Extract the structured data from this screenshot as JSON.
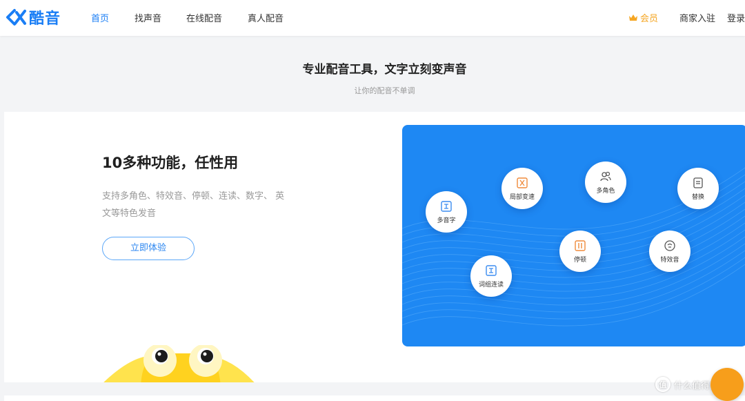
{
  "header": {
    "logo_text": "酷音",
    "brand_color": "#1a7ef5",
    "nav": [
      {
        "label": "首页",
        "active": true
      },
      {
        "label": "找声音",
        "active": false
      },
      {
        "label": "在线配音",
        "active": false
      },
      {
        "label": "真人配音",
        "active": false
      }
    ],
    "vip_label": "会员",
    "vip_color": "#f5a623",
    "merchant_label": "商家入驻",
    "login_label": "登录"
  },
  "intro": {
    "headline": "专业配音工具，文字立刻变声音",
    "subline": "让你的配音不单调"
  },
  "feature": {
    "title": "10多种功能，任性用",
    "description": "支持多角色、特效音、停顿、连读、数字、 英文等特色发音",
    "cta_label": "立即体验",
    "panel_color": "#1e88f3",
    "bubbles": [
      {
        "label": "多音字",
        "icon": "pinyin-icon"
      },
      {
        "label": "局部变速",
        "icon": "speed-icon"
      },
      {
        "label": "多角色",
        "icon": "users-icon"
      },
      {
        "label": "替换",
        "icon": "replace-icon"
      },
      {
        "label": "停顿",
        "icon": "pause-icon"
      },
      {
        "label": "特效音",
        "icon": "effect-icon"
      },
      {
        "label": "词组连读",
        "icon": "phrase-icon"
      }
    ]
  },
  "watermark": {
    "logo_text": "值",
    "text": "什么值得买"
  }
}
